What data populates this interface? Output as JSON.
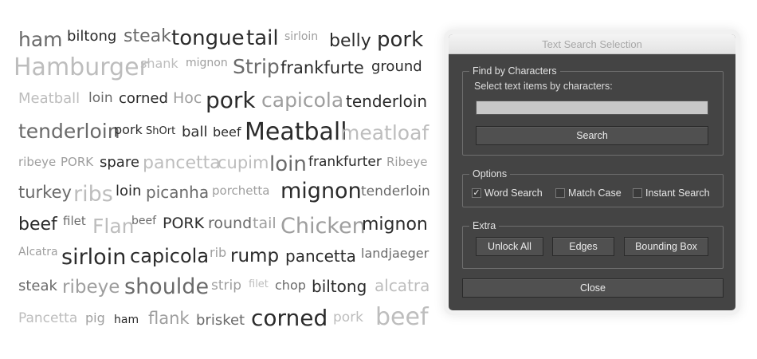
{
  "word_cloud": {
    "words": [
      "ham",
      "biltong",
      "steak",
      "tongue",
      "tail",
      "sirloin",
      "belly",
      "pork",
      "Hamburger",
      "shank",
      "mignon",
      "Strip",
      "frankfurte",
      "ground",
      "Meatball",
      "loin",
      "corned",
      "Hoc",
      "pork",
      "capicola",
      "tenderloin",
      "tenderloin",
      "pork",
      "ShOrt",
      "ball",
      "beef",
      "Meatball",
      "meatloaf",
      "ribeye",
      "PORK",
      "spare",
      "pancetta",
      "cupim",
      "loin",
      "frankfurter",
      "Ribeye",
      "turkey",
      "ribs",
      "loin",
      "picanha",
      "porchetta",
      "mignon",
      "tenderloin",
      "beef",
      "filet",
      "Flan",
      "beef",
      "PORK",
      "round",
      "tail",
      "Chicken",
      "mignon",
      "Alcatra",
      "sirloin",
      "capicola",
      "rib",
      "rump",
      "pancetta",
      "landjaeger",
      "steak",
      "ribeye",
      "shoulde",
      "strip",
      "filet",
      "chop",
      "biltong",
      "alcatra",
      "Pancetta",
      "pig",
      "ham",
      "flank",
      "brisket",
      "corned",
      "pork",
      "beef"
    ]
  },
  "dialog": {
    "title": "Text Search Selection",
    "find_group": {
      "legend": "Find by Characters",
      "instruction": "Select text items by characters:",
      "input_value": "",
      "search_label": "Search"
    },
    "options_group": {
      "legend": "Options",
      "word_search": {
        "label": "Word Search",
        "checked": true,
        "mark": "✓"
      },
      "match_case": {
        "label": "Match Case",
        "checked": false
      },
      "instant_search": {
        "label": "Instant Search",
        "checked": false
      }
    },
    "extra_group": {
      "legend": "Extra",
      "unlock_all_label": "Unlock All",
      "edges_label": "Edges",
      "bounding_box_label": "Bounding Box"
    },
    "close_label": "Close"
  }
}
